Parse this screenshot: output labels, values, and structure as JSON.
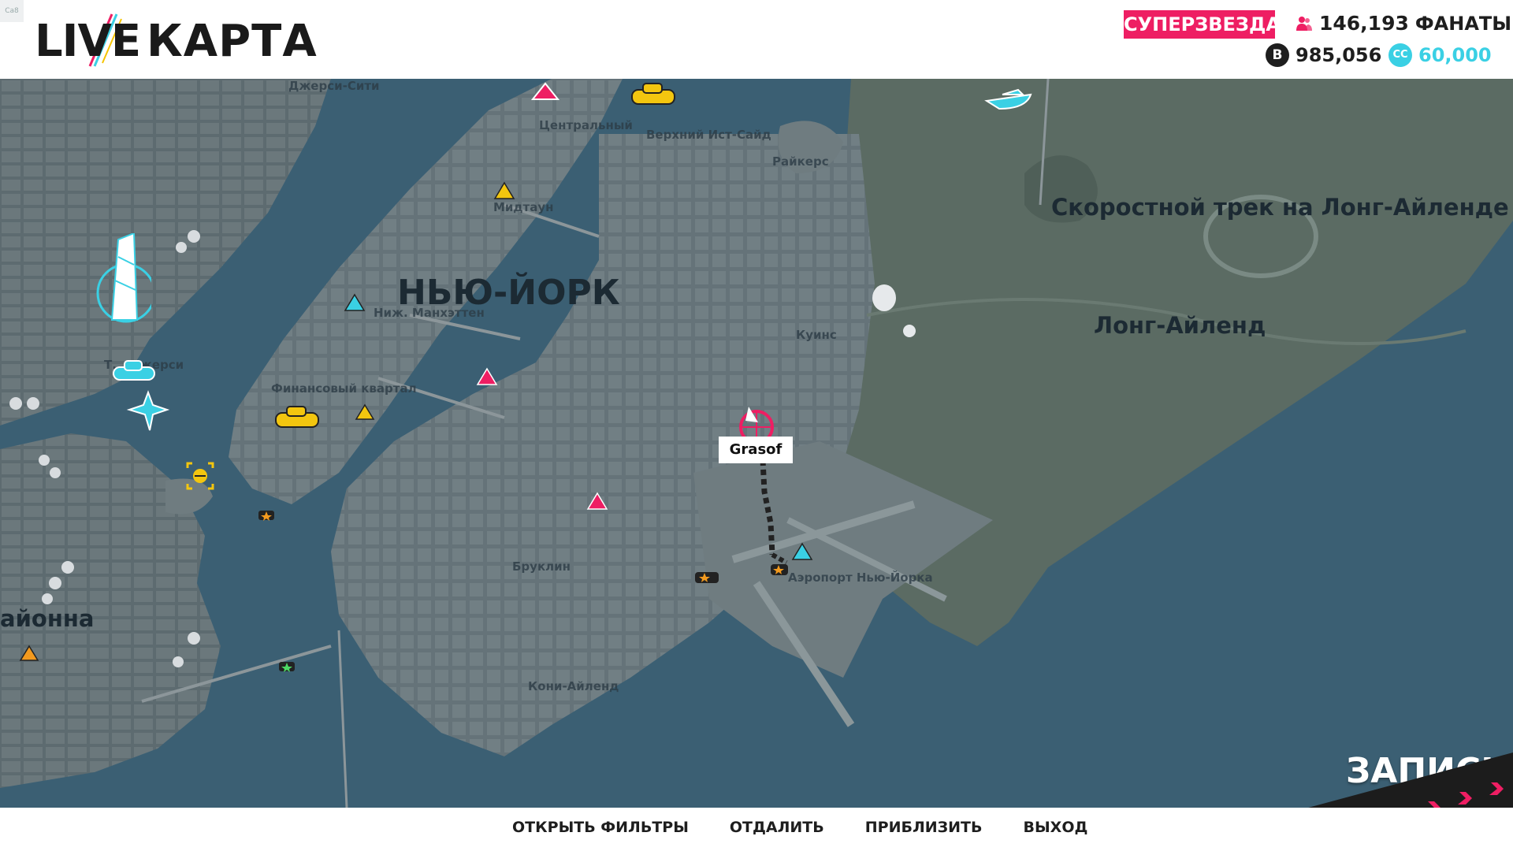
{
  "header": {
    "tag": "Ca8",
    "logo_live": "LIVE",
    "logo_map": "КАРТА",
    "rank": "СУПЕРЗВЕЗДА",
    "fans_count": "146,193",
    "fans_label": "ФАНАТЫ",
    "credits": "985,056",
    "credits_icon": "B",
    "cc_amount": "60,000",
    "cc_icon": "CC"
  },
  "map": {
    "labels": {
      "jersey_city": "Джерси-Сити",
      "central_park": "Центральный",
      "upper_east": "Верхний Ист-Сайд",
      "rikers": "Райкерс",
      "midtown": "Мидтаун",
      "new_york": "НЬЮ-ЙОРК",
      "lower_manhattan": "Ниж. Манхэттен",
      "speedway": "Скоростной трек на Лонг-Айленде",
      "long_island": "Лонг-Айленд",
      "queens": "Куинс",
      "terminal_jersey": "Т... Джерси",
      "financial": "Финансовый квартал",
      "brooklyn": "Бруклин",
      "airport": "Аэропорт Нью-Йорка",
      "coney": "Кони-Айленд",
      "region_cut": "айонна"
    },
    "player_name": "Grasof",
    "record_label": "ЗАПИСЬ",
    "colors": {
      "water": "#3b5f73",
      "land": "#5f6e74",
      "brand": "#ee1e63",
      "cyan": "#3ad0e4"
    }
  },
  "footer": {
    "open_filters": "ОТКРЫТЬ ФИЛЬТРЫ",
    "zoom_out": "ОТДАЛИТЬ",
    "zoom_in": "ПРИБЛИЗИТЬ",
    "exit": "ВЫХОД"
  }
}
